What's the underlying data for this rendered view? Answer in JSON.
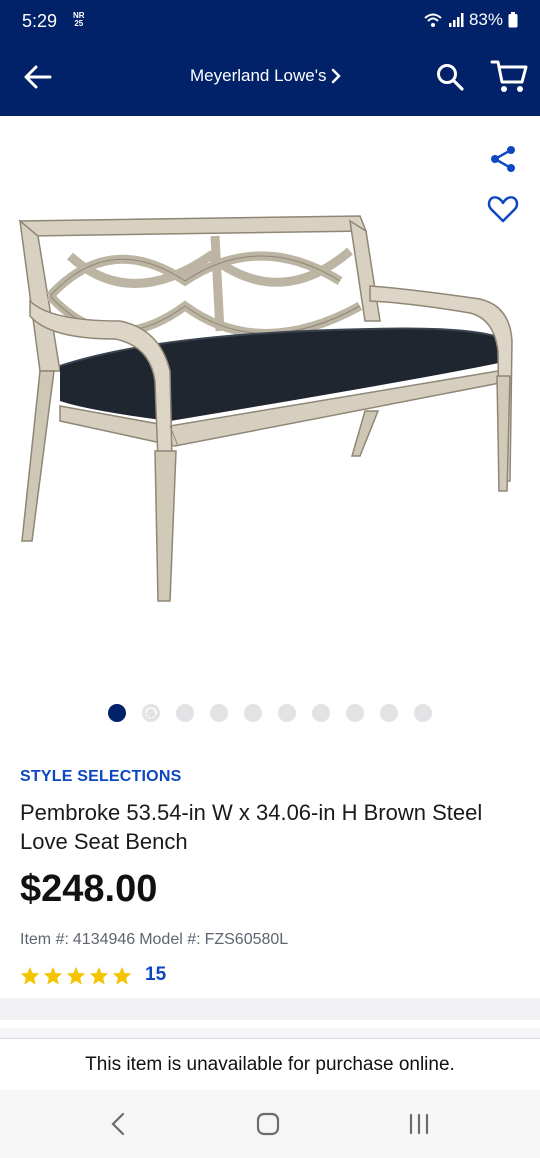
{
  "status_bar": {
    "time": "5:29",
    "notif_top": "NR",
    "notif_bottom": "25",
    "battery": "83%"
  },
  "header": {
    "store_name": "Meyerland Lowe's",
    "icons": [
      "back-arrow-icon",
      "chevron-right-icon",
      "search-icon",
      "cart-icon"
    ]
  },
  "gallery": {
    "image_count": 10,
    "active_index": 0,
    "icons": [
      "share-icon",
      "heart-icon",
      "360-spin-icon"
    ]
  },
  "product": {
    "brand": "STYLE SELECTIONS",
    "title": "Pembroke 53.54-in W x 34.06-in H Brown Steel Love Seat Bench",
    "price": "$248.00",
    "item_label": "Item #:",
    "item_number": "4134946",
    "model_label": "Model #:",
    "model_number": "FZS60580L",
    "rating_stars": 5,
    "review_count": "15"
  },
  "availability": {
    "message": "This item is unavailable for purchase online."
  },
  "colors": {
    "brand_navy": "#012169",
    "link_blue": "#0d47c2",
    "star_yellow": "#f5c400"
  }
}
